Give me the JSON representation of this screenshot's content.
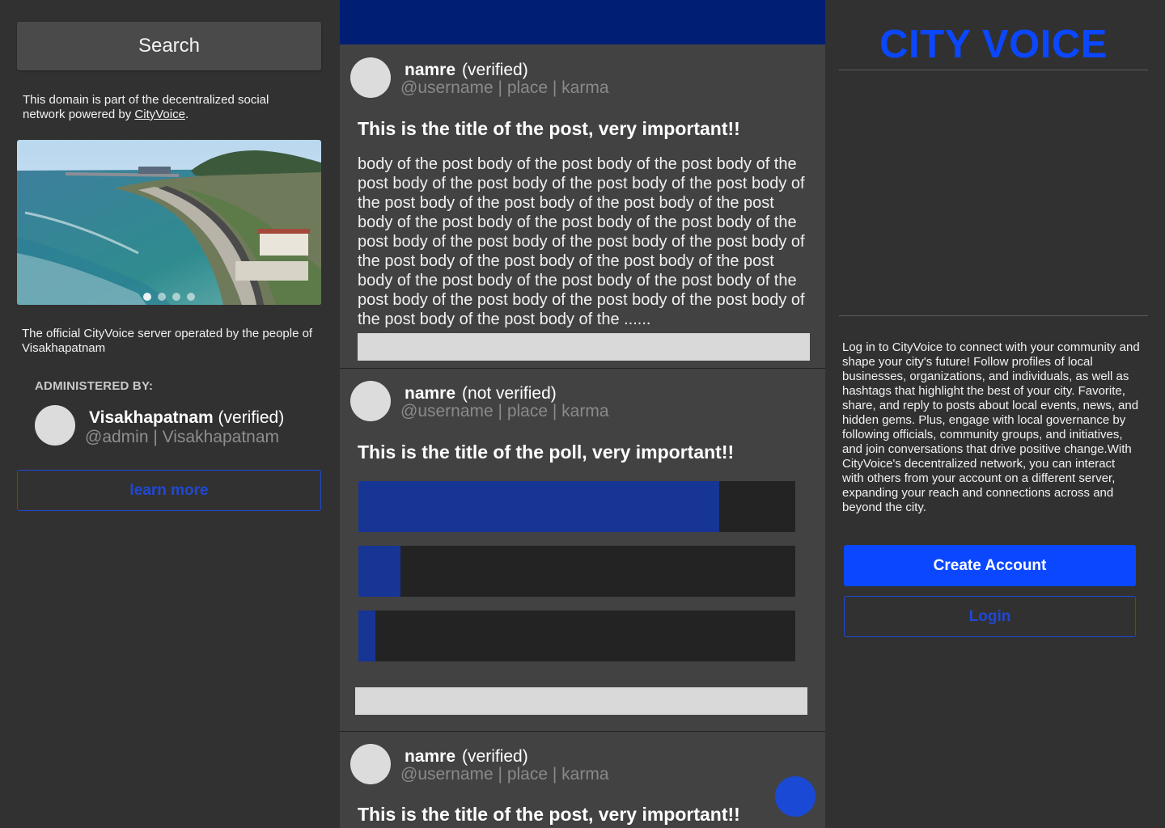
{
  "left": {
    "search_label": "Search",
    "domain_text": "This domain is part of the decentralized social network powered by ",
    "domain_link": "CityVoice",
    "domain_suffix": ".",
    "server_description": "The official CityVoice server operated by the people of Visakhapatnam",
    "admin_heading": "ADMINISTERED BY:",
    "admin": {
      "name": "Visakhapatnam",
      "status": "(verified)",
      "handle": "@admin | Visakhapatnam"
    },
    "learn_more_label": "learn more",
    "carousel": {
      "slides": 4,
      "active_index": 0
    }
  },
  "feed": {
    "posts": [
      {
        "name": "namre",
        "status": "(verified)",
        "meta": "@username | place | karma",
        "title": "This is the title of the post, very important!!",
        "body": "body of the post body of the post body of the post body of the post body of the post body of the post body of the post body of the post body of the post body of the post body of the post body of the post body of the post body of the post body of the post body of the post body of the post body of the post body of the post body of the post body of the post body of the post body of the post body of the post body of the post body of the post body of the post body of the post body of the post body of the post body of the post body of the  ......"
      },
      {
        "name": "namre",
        "status": "(not verified)",
        "meta": "@username | place | karma",
        "title": "This is the title of the poll, very important!!",
        "poll_options": [
          {
            "fraction": 0.826
          },
          {
            "fraction": 0.096
          },
          {
            "fraction": 0.039
          }
        ]
      },
      {
        "name": "namre",
        "status": "(verified)",
        "meta": "@username | place | karma",
        "title": "This is the title of the post, very important!!"
      }
    ]
  },
  "right": {
    "brand": "CITY VOICE",
    "intro": "Log in to CityVoice to connect with your community and shape your city's future! Follow profiles of local businesses, organizations, and individuals, as well as hashtags that highlight the best of your city.  Favorite, share, and reply to posts about local events, news, and hidden gems. Plus, engage with local governance by following officials, community groups, and initiatives, and join conversations that drive positive change.With CityVoice's decentralized network, you can interact with others from your account on a different server, expanding  your reach and connections across and beyond the city.",
    "create_account_label": "Create Account",
    "login_label": "Login"
  },
  "colors": {
    "accent": "#0a47ff",
    "topbar": "#001f74",
    "poll_fill": "#173594",
    "background": "#313131",
    "feed_background": "#424242"
  }
}
